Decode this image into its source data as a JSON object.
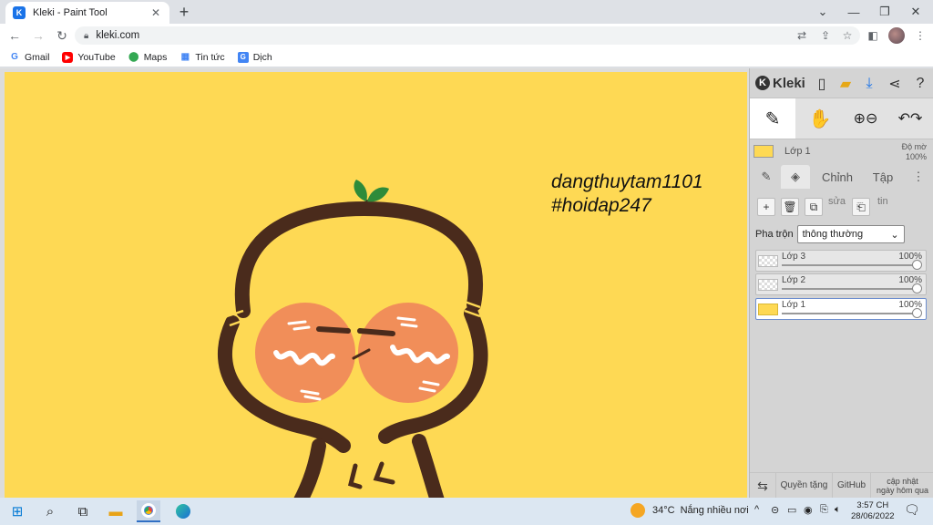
{
  "browser": {
    "tab_title": "Kleki - Paint Tool",
    "tab_close": "✕",
    "new_tab": "+",
    "url": "kleki.com",
    "window_controls": [
      "minimize",
      "restore",
      "close"
    ]
  },
  "bookmarks": [
    {
      "label": "Gmail",
      "icon": "gmail-icon"
    },
    {
      "label": "YouTube",
      "icon": "youtube-icon"
    },
    {
      "label": "Maps",
      "icon": "maps-icon"
    },
    {
      "label": "Tin tức",
      "icon": "news-icon"
    },
    {
      "label": "Dịch",
      "icon": "translate-icon"
    }
  ],
  "canvas": {
    "background_color": "#fed954",
    "signature_line1": "dangthuytam1101",
    "signature_line2": "#hoidap247"
  },
  "panel": {
    "logo": "Kleki",
    "current_layer": {
      "name": "Lớp 1",
      "opacity_label": "Độ mờ",
      "opacity_value": "100%"
    },
    "tabs": {
      "edit": "Chỉnh",
      "file": "Tập"
    },
    "actions": {
      "label_edit": "sửa",
      "label_info": "tin"
    },
    "blend": {
      "label": "Pha trộn",
      "value": "thông thường"
    },
    "layers": [
      {
        "name": "Lớp 3",
        "opacity": "100%"
      },
      {
        "name": "Lớp 2",
        "opacity": "100%"
      },
      {
        "name": "Lớp 1",
        "opacity": "100%"
      }
    ],
    "bottom": {
      "privacy": "Quyền tặng",
      "github": "GitHub",
      "update_line1": "cập nhật",
      "update_line2": "ngày hôm qua"
    }
  },
  "taskbar": {
    "weather_temp": "34°C",
    "weather_text": "Nắng nhiều nơi",
    "time": "3:57 CH",
    "date": "28/06/2022"
  }
}
